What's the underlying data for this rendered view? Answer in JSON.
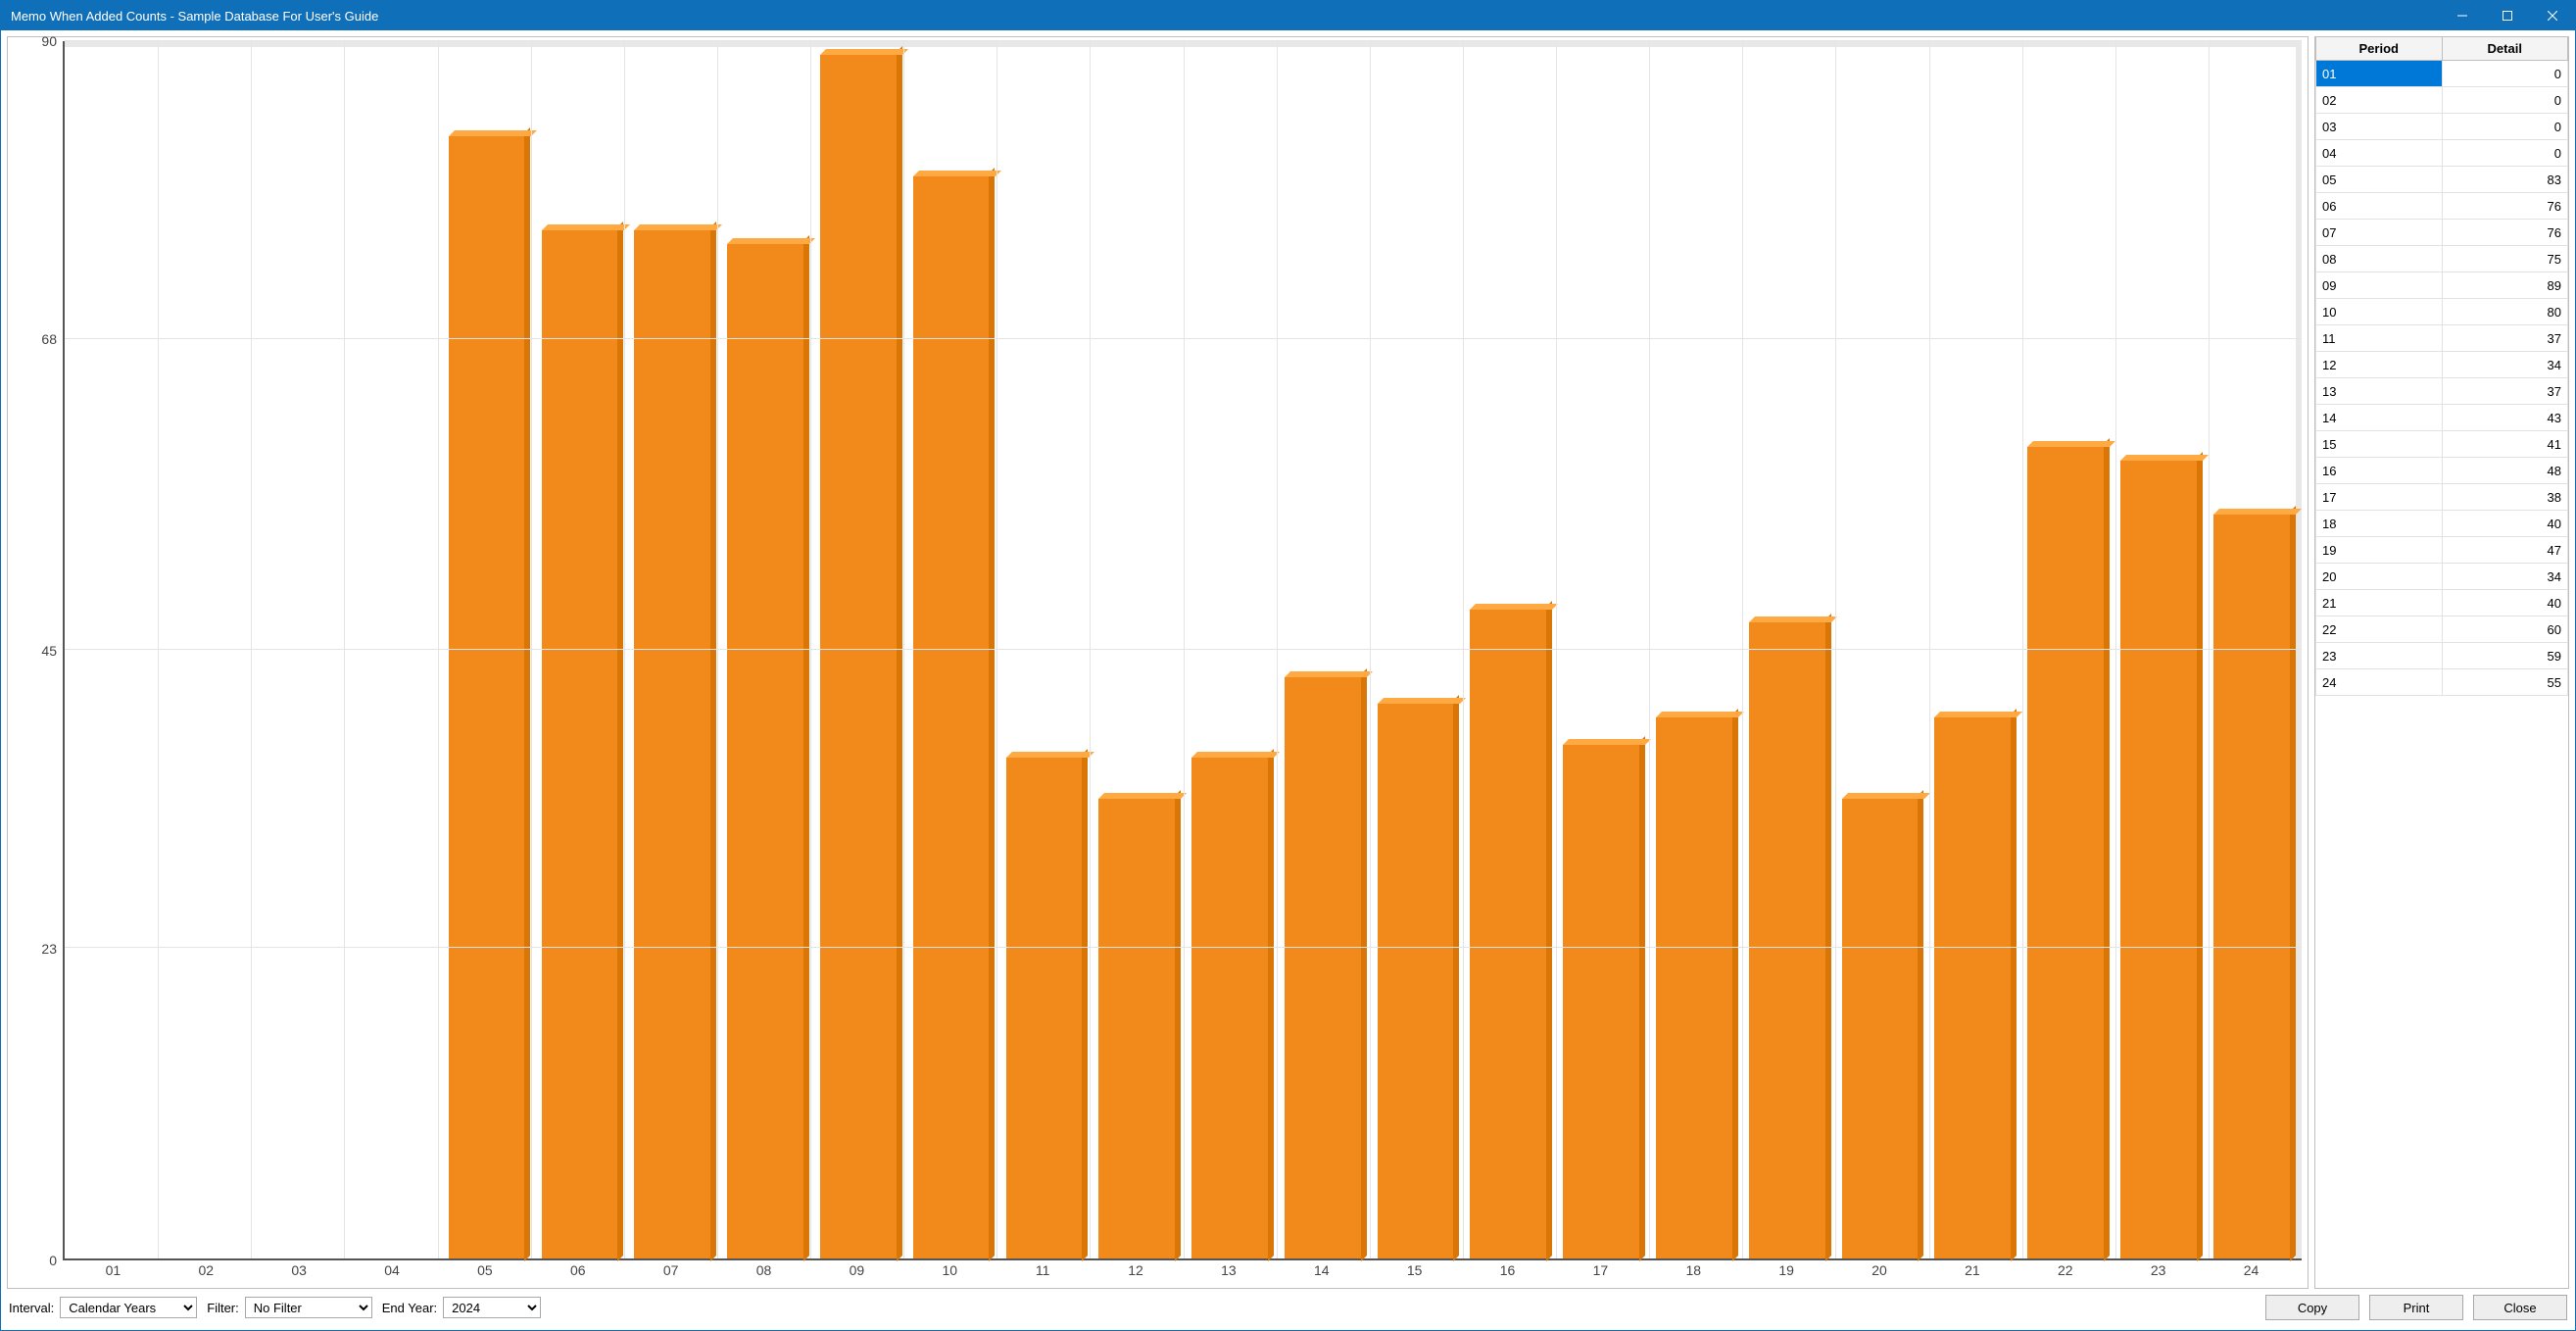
{
  "window": {
    "title": "Memo When Added Counts - Sample Database For User's Guide"
  },
  "chart_data": {
    "type": "bar",
    "categories": [
      "01",
      "02",
      "03",
      "04",
      "05",
      "06",
      "07",
      "08",
      "09",
      "10",
      "11",
      "12",
      "13",
      "14",
      "15",
      "16",
      "17",
      "18",
      "19",
      "20",
      "21",
      "22",
      "23",
      "24"
    ],
    "values": [
      0,
      0,
      0,
      0,
      83,
      76,
      76,
      75,
      89,
      80,
      37,
      34,
      37,
      43,
      41,
      48,
      38,
      40,
      47,
      34,
      40,
      60,
      59,
      55
    ],
    "xlabel": "",
    "ylabel": "",
    "ylim": [
      0,
      90
    ],
    "yticks": [
      0,
      23,
      45,
      68,
      90
    ],
    "bar_color": "#f28a1b",
    "title": ""
  },
  "table": {
    "columns": {
      "period": "Period",
      "detail": "Detail"
    },
    "rows": [
      {
        "period": "01",
        "detail": 0
      },
      {
        "period": "02",
        "detail": 0
      },
      {
        "period": "03",
        "detail": 0
      },
      {
        "period": "04",
        "detail": 0
      },
      {
        "period": "05",
        "detail": 83
      },
      {
        "period": "06",
        "detail": 76
      },
      {
        "period": "07",
        "detail": 76
      },
      {
        "period": "08",
        "detail": 75
      },
      {
        "period": "09",
        "detail": 89
      },
      {
        "period": "10",
        "detail": 80
      },
      {
        "period": "11",
        "detail": 37
      },
      {
        "period": "12",
        "detail": 34
      },
      {
        "period": "13",
        "detail": 37
      },
      {
        "period": "14",
        "detail": 43
      },
      {
        "period": "15",
        "detail": 41
      },
      {
        "period": "16",
        "detail": 48
      },
      {
        "period": "17",
        "detail": 38
      },
      {
        "period": "18",
        "detail": 40
      },
      {
        "period": "19",
        "detail": 47
      },
      {
        "period": "20",
        "detail": 34
      },
      {
        "period": "21",
        "detail": 40
      },
      {
        "period": "22",
        "detail": 60
      },
      {
        "period": "23",
        "detail": 59
      },
      {
        "period": "24",
        "detail": 55
      }
    ],
    "selected_index": 0
  },
  "controls": {
    "interval": {
      "label": "Interval:",
      "value": "Calendar Years"
    },
    "filter": {
      "label": "Filter:",
      "value": "No Filter"
    },
    "end_year": {
      "label": "End Year:",
      "value": "2024"
    }
  },
  "buttons": {
    "copy": "Copy",
    "print": "Print",
    "close": "Close"
  }
}
